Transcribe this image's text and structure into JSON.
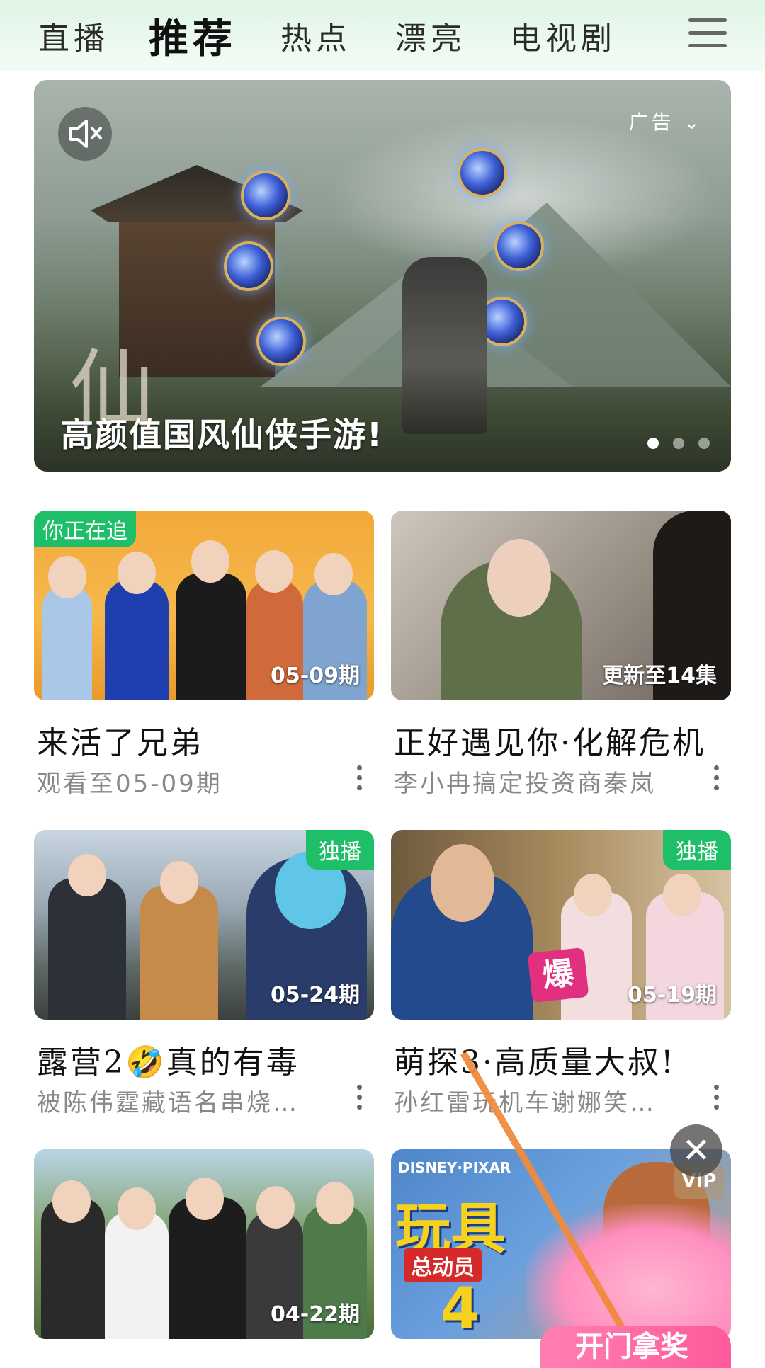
{
  "nav": {
    "tabs": [
      "直播",
      "推荐",
      "热点",
      "漂亮",
      "电视剧"
    ],
    "active_tab": "推荐"
  },
  "banner": {
    "ad_label": "广告",
    "title": "高颜值国风仙侠手游!",
    "overlay_char": "仙",
    "page_count": 3,
    "active_page": 1
  },
  "cards": [
    {
      "title": "来活了兄弟",
      "subtitle": "观看至05-09期",
      "overlay": "05-09期",
      "badge": "你正在追",
      "badge_side": "left"
    },
    {
      "title": "正好遇见你·化解危机",
      "subtitle": "李小冉搞定投资商秦岚",
      "overlay": "更新至14集",
      "badge": "",
      "badge_side": ""
    },
    {
      "title": "露营2🤣真的有毒",
      "subtitle": "被陈伟霆藏语名串烧…",
      "overlay": "05-24期",
      "badge": "独播",
      "badge_side": "right"
    },
    {
      "title": "萌探3·高质量大叔!",
      "subtitle": "孙红雷玩机车谢娜笑…",
      "overlay": "05-19期",
      "badge": "独播",
      "badge_side": "right"
    },
    {
      "title": "",
      "subtitle": "",
      "overlay": "04-22期",
      "badge": "",
      "badge_side": ""
    },
    {
      "title": "",
      "subtitle": "",
      "overlay": "",
      "badge": "",
      "badge_side": "",
      "poster_title": "玩具",
      "poster_sub": "总动员",
      "poster_num": "4",
      "poster_brand": "DISNEY·PIXAR"
    }
  ],
  "promo": {
    "vip_label": "VIP",
    "button_text": "开门拿奖",
    "close_symbol": "✕"
  },
  "colors": {
    "accent": "#1fbf6a",
    "promo": "#ff5a9b"
  }
}
